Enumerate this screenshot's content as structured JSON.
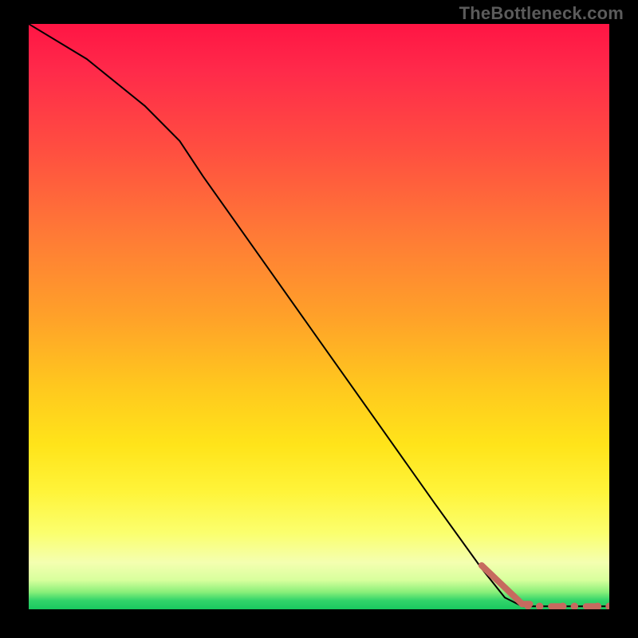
{
  "watermark": "TheBottleneck.com",
  "chart_data": {
    "type": "line",
    "title": "",
    "xlabel": "",
    "ylabel": "",
    "xlim": [
      0,
      100
    ],
    "ylim": [
      0,
      100
    ],
    "background_gradient": {
      "direction": "vertical",
      "stops": [
        {
          "pos": 0,
          "color": "#ff1544"
        },
        {
          "pos": 50,
          "color": "#ffa129"
        },
        {
          "pos": 80,
          "color": "#fff43a"
        },
        {
          "pos": 97,
          "color": "#8cf07a"
        },
        {
          "pos": 100,
          "color": "#19c95f"
        }
      ]
    },
    "series": [
      {
        "name": "curve",
        "style": "solid-black",
        "points": [
          {
            "x": 0,
            "y": 100
          },
          {
            "x": 10,
            "y": 94
          },
          {
            "x": 20,
            "y": 86
          },
          {
            "x": 26,
            "y": 80
          },
          {
            "x": 30,
            "y": 74
          },
          {
            "x": 40,
            "y": 60
          },
          {
            "x": 50,
            "y": 46
          },
          {
            "x": 60,
            "y": 32
          },
          {
            "x": 70,
            "y": 18
          },
          {
            "x": 78,
            "y": 7
          },
          {
            "x": 82,
            "y": 2
          },
          {
            "x": 85,
            "y": 0.5
          },
          {
            "x": 100,
            "y": 0.5
          }
        ]
      },
      {
        "name": "tail-markers",
        "style": "salmon-dots",
        "points": [
          {
            "x": 78,
            "y": 7.5
          },
          {
            "x": 79,
            "y": 6.3
          },
          {
            "x": 80,
            "y": 5.2
          },
          {
            "x": 81,
            "y": 4.1
          },
          {
            "x": 82,
            "y": 3.1
          },
          {
            "x": 83,
            "y": 2.2
          },
          {
            "x": 84,
            "y": 1.4
          },
          {
            "x": 85,
            "y": 0.9
          },
          {
            "x": 86,
            "y": 0.6
          },
          {
            "x": 88,
            "y": 0.5
          },
          {
            "x": 90,
            "y": 0.5
          },
          {
            "x": 92,
            "y": 0.5
          },
          {
            "x": 94,
            "y": 0.5
          },
          {
            "x": 96,
            "y": 0.5
          },
          {
            "x": 98,
            "y": 0.5
          },
          {
            "x": 100,
            "y": 0.5
          }
        ]
      }
    ]
  }
}
